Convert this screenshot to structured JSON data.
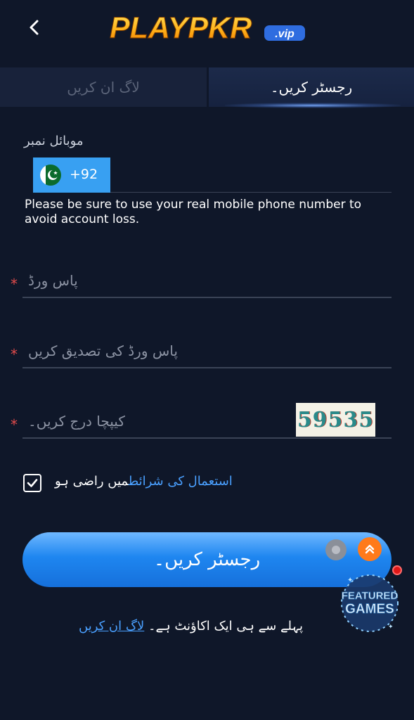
{
  "header": {
    "back_icon": "chevron-left-icon",
    "logo_text": "PLAYPKR",
    "logo_badge": ".vip"
  },
  "tabs": [
    {
      "label": "لاگ ان کریں",
      "active": false
    },
    {
      "label": "رجسٹر کریں۔",
      "active": true
    }
  ],
  "form": {
    "mobile_label": "موبائل نمبر",
    "country_code": "+92",
    "country_flag": "pakistan-flag-icon",
    "phone_value": "",
    "phone_note": "Please be sure to use your real mobile phone number to avoid account loss.",
    "password_placeholder": "پاس ورڈ",
    "confirm_password_placeholder": "پاس ورڈ کی تصدیق کریں",
    "captcha_placeholder": "کیپچا درج کریں۔",
    "required_mark": "*",
    "captcha_code": "59535",
    "terms_checked": true,
    "terms_text": "میں راضی ہو",
    "terms_link": "استعمال کی شرائط"
  },
  "register_button": "رجسٹر کریں۔",
  "floating": {
    "featured_line1": "FEATURED",
    "featured_line2": "GAMES"
  },
  "footer": {
    "login_link": "لاگ ان کریں",
    "text": "پہلے سے ہی ایک اکاؤنٹ ہے۔"
  },
  "colors": {
    "background": "#0f1729",
    "accent_blue": "#1e86f0",
    "link_blue": "#4aa0ff",
    "required_red": "#e24b4b",
    "scroll_orange": "#ff7a1a"
  }
}
